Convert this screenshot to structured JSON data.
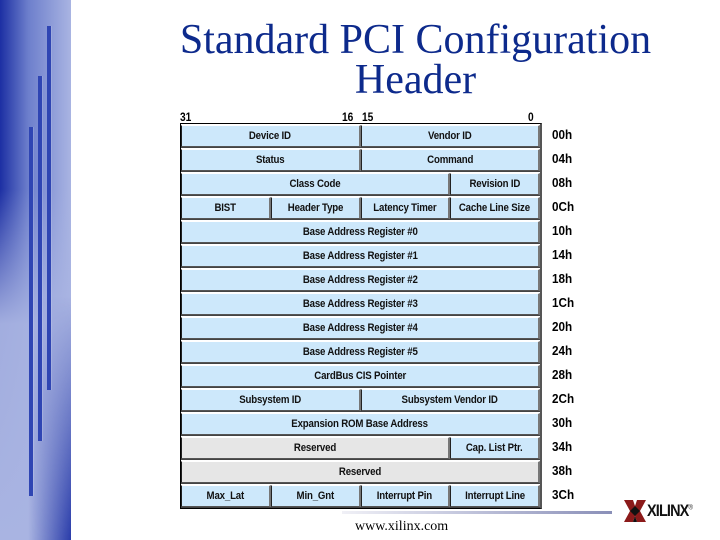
{
  "slide": {
    "title_line1": "Standard PCI Configuration",
    "title_line2": "Header",
    "footer_url": "www.xilinx.com",
    "logo": {
      "icon": "xilinx-logo-icon",
      "text": "XILINX",
      "registered": "®",
      "colors": {
        "mark_red": "#8b1a1a",
        "mark_black": "#111111"
      }
    },
    "colors": {
      "title": "#0d2a8c",
      "cell_fill": "#cde8fb",
      "reserved_fill": "#e6e6e6",
      "sidebar_dark": "#1c2fa3",
      "sidebar_light": "#a9b4e2"
    }
  },
  "bit_labels": {
    "b31": "31",
    "b16": "16",
    "b15": "15",
    "b0": "0"
  },
  "rows": [
    {
      "offset": "00h",
      "cells": [
        {
          "label": "Device ID",
          "span": 2
        },
        {
          "label": "Vendor ID",
          "span": 2
        }
      ]
    },
    {
      "offset": "04h",
      "cells": [
        {
          "label": "Status",
          "span": 2
        },
        {
          "label": "Command",
          "span": 2
        }
      ]
    },
    {
      "offset": "08h",
      "cells": [
        {
          "label": "Class Code",
          "span": 3
        },
        {
          "label": "Revision ID",
          "span": 1
        }
      ]
    },
    {
      "offset": "0Ch",
      "cells": [
        {
          "label": "BIST",
          "span": 1
        },
        {
          "label": "Header Type",
          "span": 1
        },
        {
          "label": "Latency Timer",
          "span": 1
        },
        {
          "label": "Cache Line Size",
          "span": 1
        }
      ]
    },
    {
      "offset": "10h",
      "cells": [
        {
          "label": "Base Address Register #0",
          "span": 4
        }
      ]
    },
    {
      "offset": "14h",
      "cells": [
        {
          "label": "Base Address Register #1",
          "span": 4
        }
      ]
    },
    {
      "offset": "18h",
      "cells": [
        {
          "label": "Base Address Register #2",
          "span": 4
        }
      ]
    },
    {
      "offset": "1Ch",
      "cells": [
        {
          "label": "Base Address Register #3",
          "span": 4
        }
      ]
    },
    {
      "offset": "20h",
      "cells": [
        {
          "label": "Base Address Register #4",
          "span": 4
        }
      ]
    },
    {
      "offset": "24h",
      "cells": [
        {
          "label": "Base Address Register #5",
          "span": 4
        }
      ]
    },
    {
      "offset": "28h",
      "cells": [
        {
          "label": "CardBus CIS Pointer",
          "span": 4
        }
      ]
    },
    {
      "offset": "2Ch",
      "cells": [
        {
          "label": "Subsystem ID",
          "span": 2
        },
        {
          "label": "Subsystem Vendor ID",
          "span": 2
        }
      ]
    },
    {
      "offset": "30h",
      "cells": [
        {
          "label": "Expansion ROM Base Address",
          "span": 4
        }
      ]
    },
    {
      "offset": "34h",
      "cells": [
        {
          "label": "Reserved",
          "span": 3,
          "reserved": true
        },
        {
          "label": "Cap. List Ptr.",
          "span": 1
        }
      ]
    },
    {
      "offset": "38h",
      "cells": [
        {
          "label": "Reserved",
          "span": 4,
          "reserved": true
        }
      ]
    },
    {
      "offset": "3Ch",
      "cells": [
        {
          "label": "Max_Lat",
          "span": 1
        },
        {
          "label": "Min_Gnt",
          "span": 1
        },
        {
          "label": "Interrupt Pin",
          "span": 1
        },
        {
          "label": "Interrupt Line",
          "span": 1
        }
      ]
    }
  ]
}
